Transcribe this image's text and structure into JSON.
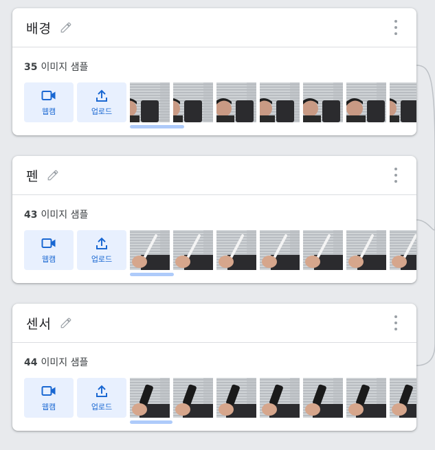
{
  "classes": [
    {
      "name": "배경",
      "count": "35",
      "count_suffix": "이미지 샘플",
      "webcam_label": "웹캠",
      "upload_label": "업로드",
      "thumb_subject": "person"
    },
    {
      "name": "펜",
      "count": "43",
      "count_suffix": "이미지 샘플",
      "webcam_label": "웹캠",
      "upload_label": "업로드",
      "thumb_subject": "pen"
    },
    {
      "name": "센서",
      "count": "44",
      "count_suffix": "이미지 샘플",
      "webcam_label": "웹캠",
      "upload_label": "업로드",
      "thumb_subject": "sensor"
    }
  ],
  "icons": {
    "edit": "pencil-icon",
    "more": "more-vert-icon",
    "webcam": "videocam-icon",
    "upload": "upload-icon"
  },
  "colors": {
    "accent": "#1967d2",
    "button_bg": "#e8f0fe",
    "scroll_indicator": "#aecbfa",
    "background": "#e8eaed"
  }
}
